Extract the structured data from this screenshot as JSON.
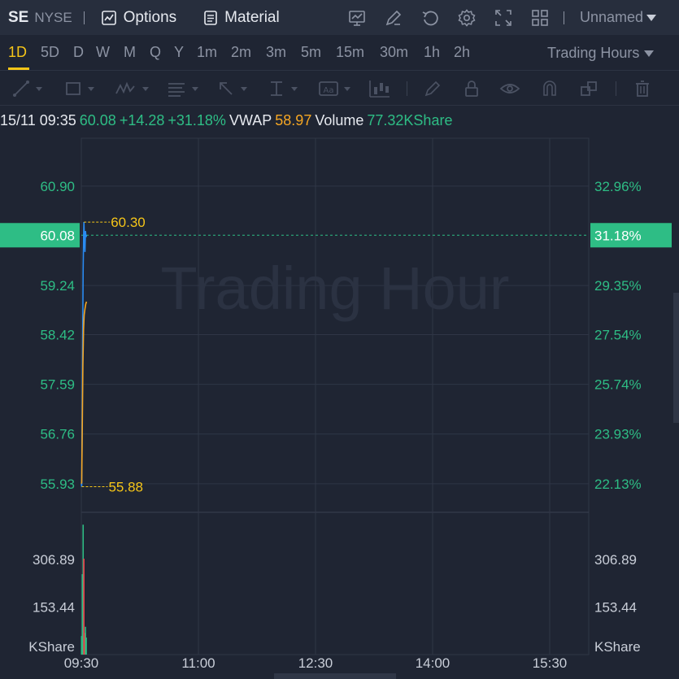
{
  "header": {
    "ticker": "SE",
    "exchange": "NYSE",
    "options_label": "Options",
    "material_label": "Material",
    "layout_name": "Unnamed",
    "icons": [
      "indicator-chart-icon",
      "draw-edit-icon",
      "undo-icon",
      "settings-gear-icon",
      "fullscreen-icon",
      "layout-grid-icon"
    ]
  },
  "periods": {
    "items": [
      "1D",
      "5D",
      "D",
      "W",
      "M",
      "Q",
      "Y",
      "1m",
      "2m",
      "3m",
      "5m",
      "15m",
      "30m",
      "1h",
      "2h"
    ],
    "active": "1D",
    "session_label": "Trading Hours"
  },
  "draw_tools": [
    "trend-line-icon",
    "rectangle-icon",
    "pattern-icon",
    "fib-icon",
    "arrow-icon",
    "measure-icon",
    "text-icon",
    "candle-icon",
    "pen-icon",
    "lock-icon",
    "eye-icon",
    "magnet-icon",
    "copy-icon",
    "trash-icon"
  ],
  "info": {
    "datetime": "15/11 09:35",
    "price": "60.08",
    "change": "+14.28",
    "change_pct": "+31.18%",
    "vwap_label": "VWAP",
    "vwap_value": "58.97",
    "volume_label": "Volume",
    "volume_value": "77.32KShare"
  },
  "watermark": "Trading Hour",
  "colors": {
    "up": "#2ebd85",
    "down": "#f23645",
    "price_line": "#2a8bf2",
    "vwap_line": "#f5a623",
    "highlight": "#f5c518"
  },
  "chart_data": {
    "type": "line",
    "x_ticks": [
      "09:30",
      "11:00",
      "12:30",
      "14:00",
      "15:30"
    ],
    "x_tick_minutes": [
      0,
      90,
      180,
      270,
      360
    ],
    "x_range_minutes": [
      0,
      390
    ],
    "price_axis": {
      "ticks": [
        60.9,
        59.24,
        58.42,
        57.59,
        56.76,
        55.93
      ],
      "tick_labels": [
        "60.90",
        "59.24",
        "58.42",
        "57.59",
        "56.76",
        "55.93"
      ],
      "ylim": [
        55.52,
        61.7
      ]
    },
    "percent_axis": {
      "tick_labels": [
        "32.96%",
        "29.35%",
        "27.54%",
        "25.74%",
        "23.93%",
        "22.13%"
      ]
    },
    "current": {
      "price": "60.08",
      "percent": "31.18%",
      "value": 60.08
    },
    "high": {
      "label": "60.30",
      "value": 60.3,
      "minute": 2
    },
    "low": {
      "label": "55.88",
      "value": 55.88,
      "minute": 0.3
    },
    "series": [
      {
        "key": "price",
        "points": [
          [
            0,
            55.93
          ],
          [
            0.3,
            55.88
          ],
          [
            0.6,
            56.9
          ],
          [
            1.0,
            58.2
          ],
          [
            1.4,
            59.5
          ],
          [
            1.8,
            60.1
          ],
          [
            2.0,
            60.3
          ],
          [
            2.4,
            60.0
          ],
          [
            2.8,
            59.8
          ],
          [
            3.2,
            60.15
          ],
          [
            3.6,
            60.05
          ],
          [
            4.0,
            60.08
          ]
        ]
      },
      {
        "key": "vwap",
        "points": [
          [
            0,
            55.93
          ],
          [
            0.3,
            55.95
          ],
          [
            0.7,
            56.8
          ],
          [
            1.2,
            57.9
          ],
          [
            1.7,
            58.5
          ],
          [
            2.2,
            58.75
          ],
          [
            2.8,
            58.85
          ],
          [
            3.4,
            58.93
          ],
          [
            4.0,
            58.97
          ]
        ]
      }
    ],
    "volume_axis": {
      "ticks": [
        306.89,
        153.44
      ],
      "tick_labels": [
        "306.89",
        "153.44"
      ],
      "unit": "KShare",
      "ylim": [
        0,
        460
      ]
    },
    "volume_bars": [
      {
        "minute": 0.2,
        "value": 60,
        "dir": "up"
      },
      {
        "minute": 0.8,
        "value": 260,
        "dir": "up"
      },
      {
        "minute": 1.4,
        "value": 420,
        "dir": "up"
      },
      {
        "minute": 2.0,
        "value": 310,
        "dir": "down"
      },
      {
        "minute": 2.6,
        "value": 70,
        "dir": "down"
      },
      {
        "minute": 3.2,
        "value": 90,
        "dir": "up"
      },
      {
        "minute": 3.8,
        "value": 55,
        "dir": "up"
      }
    ]
  }
}
